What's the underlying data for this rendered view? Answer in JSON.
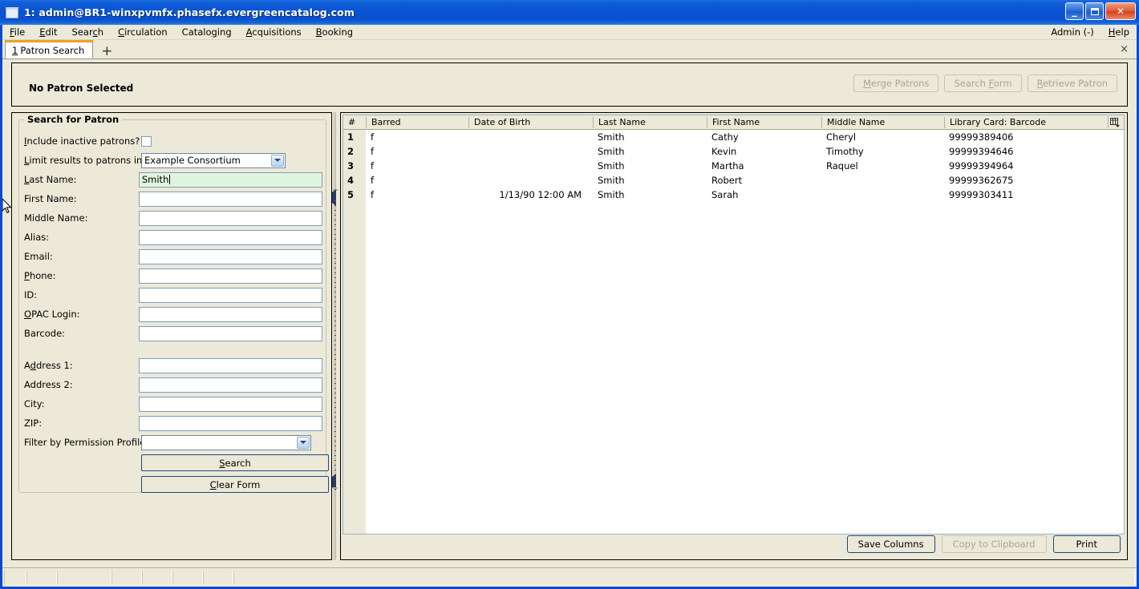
{
  "window": {
    "title": "1: admin@BR1-winxpvmfx.phasefx.evergreencatalog.com",
    "icon": "window-icon",
    "minimize": "_",
    "maximize": "maximize-icon",
    "close": "✕"
  },
  "menubar": {
    "left": [
      {
        "pre": "F",
        "post": "ile"
      },
      {
        "pre": "E",
        "post": "dit"
      },
      {
        "pre": "Sear",
        "post": "c",
        "tail": "h"
      },
      {
        "pre": "C",
        "post": "irculation"
      },
      {
        "pre": "Catalo",
        "post": "g",
        "tail": "ing"
      },
      {
        "pre": "A",
        "post": "cquisitions"
      },
      {
        "pre": "B",
        "post": "ooking"
      }
    ],
    "left_labels": [
      "File",
      "Edit",
      "Search",
      "Circulation",
      "Cataloging",
      "Acquisitions",
      "Booking"
    ],
    "right_labels": [
      "Admin (-)",
      "Help"
    ],
    "admin": "Admin (-)",
    "help": "Help"
  },
  "tabs": {
    "active_number": "1",
    "active_label": "Patron Search",
    "new_tab": "+",
    "close_all": "×"
  },
  "patron_header": {
    "status": "No Patron Selected",
    "buttons": [
      {
        "label": "Merge Patrons",
        "disabled": true
      },
      {
        "label": "Search Form",
        "disabled": true
      },
      {
        "label": "Retrieve Patron",
        "disabled": true
      }
    ],
    "merge_patrons": "Merge Patrons",
    "search_form": "Search Form",
    "retrieve_patron": "Retrieve Patron"
  },
  "search_form": {
    "group_title": "Search for Patron",
    "fields": [
      {
        "label": "Include inactive patrons?",
        "type": "checkbox",
        "value": "",
        "checked": false
      },
      {
        "label": "Limit results to patrons in",
        "type": "select",
        "value": "Example Consortium"
      },
      {
        "label": "Last Name:",
        "type": "text",
        "value": "Smith",
        "focused": true
      },
      {
        "label": "First Name:",
        "type": "text",
        "value": ""
      },
      {
        "label": "Middle Name:",
        "type": "text",
        "value": ""
      },
      {
        "label": "Alias:",
        "type": "text",
        "value": ""
      },
      {
        "label": "Email:",
        "type": "text",
        "value": ""
      },
      {
        "label": "Phone:",
        "type": "text",
        "value": ""
      },
      {
        "label": "ID:",
        "type": "text",
        "value": ""
      },
      {
        "label": "OPAC Login:",
        "type": "text",
        "value": ""
      },
      {
        "label": "Barcode:",
        "type": "text",
        "value": ""
      },
      {
        "label": "Address 1:",
        "type": "text",
        "value": ""
      },
      {
        "label": "Address 2:",
        "type": "text",
        "value": ""
      },
      {
        "label": "City:",
        "type": "text",
        "value": ""
      },
      {
        "label": "ZIP:",
        "type": "text",
        "value": ""
      },
      {
        "label": "Filter by Permission Profile:",
        "type": "select",
        "value": ""
      }
    ],
    "search_button": "Search",
    "clear_button": "Clear Form"
  },
  "results": {
    "columns": [
      "#",
      "Barred",
      "Date of Birth",
      "Last Name",
      "First Name",
      "Middle Name",
      "Library Card: Barcode"
    ],
    "rows": [
      {
        "num": "1",
        "barred": "f",
        "dob": "",
        "last": "Smith",
        "first": "Cathy",
        "middle": "Cheryl",
        "barcode": "99999389406"
      },
      {
        "num": "2",
        "barred": "f",
        "dob": "",
        "last": "Smith",
        "first": "Kevin",
        "middle": "Timothy",
        "barcode": "99999394646"
      },
      {
        "num": "3",
        "barred": "f",
        "dob": "",
        "last": "Smith",
        "first": "Martha",
        "middle": "Raquel",
        "barcode": "99999394964"
      },
      {
        "num": "4",
        "barred": "f",
        "dob": "",
        "last": "Smith",
        "first": "Robert",
        "middle": "",
        "barcode": "99999362675"
      },
      {
        "num": "5",
        "barred": "f",
        "dob": "1/13/90 12:00 AM",
        "last": "Smith",
        "first": "Sarah",
        "middle": "",
        "barcode": "99999303411"
      }
    ],
    "column_picker_icon": "column-picker-icon",
    "buttons": [
      {
        "label": "Save Columns",
        "disabled": false
      },
      {
        "label": "Copy to Clipboard",
        "disabled": true
      },
      {
        "label": "Print",
        "disabled": false
      }
    ],
    "save_columns": "Save Columns",
    "copy_to_clipboard": "Copy to Clipboard",
    "print": "Print"
  },
  "colors": {
    "titlebar_blue": "#0a55d4",
    "chrome_beige": "#ece9d8",
    "focused_field_green": "#e0f5e0",
    "active_tab_accent": "#f0a020",
    "button_border": "#1a4a7a"
  }
}
